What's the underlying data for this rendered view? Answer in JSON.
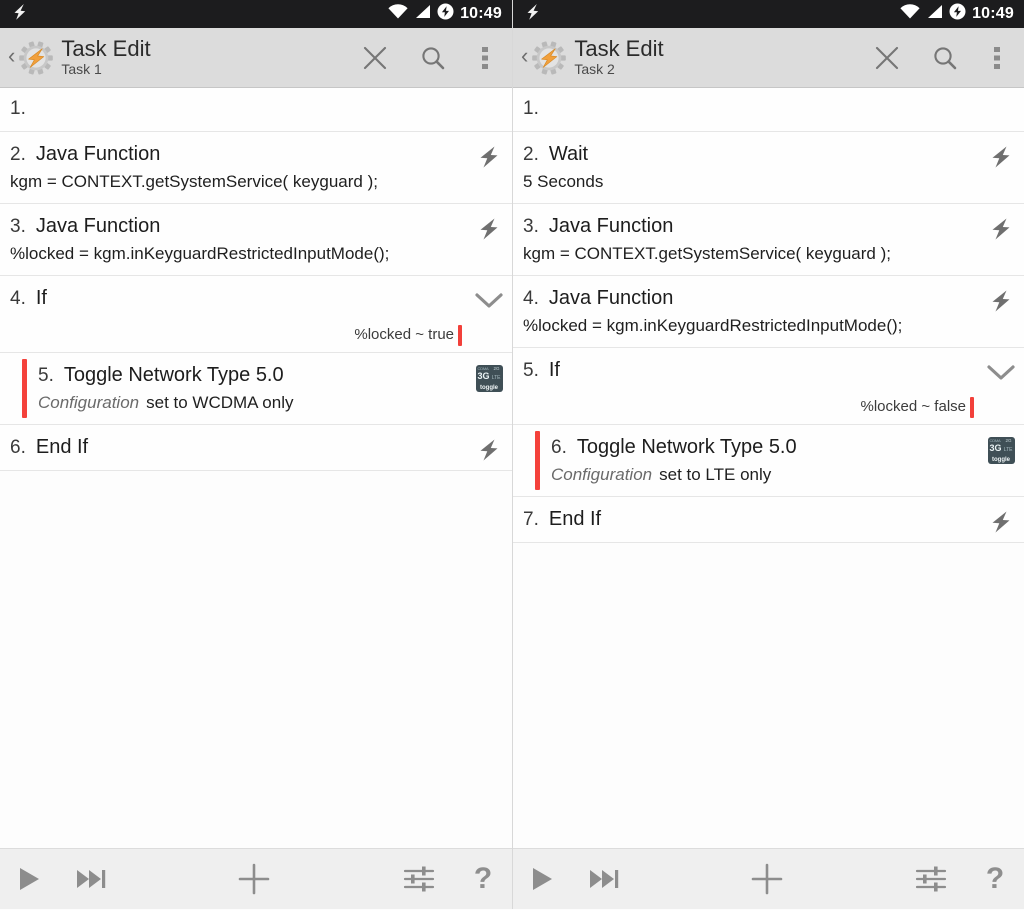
{
  "colors": {
    "statusbar_bg": "#1c1c1e",
    "actionbar_bg": "#dcdcdc",
    "accent_red": "#f2403a",
    "icon_gray": "#8e8e8e",
    "net_icon_bg": "#3f4f56",
    "brand_orange": "#f2a03c"
  },
  "panels": [
    {
      "id": "left",
      "statusbar": {
        "left_icon": "tasker-bolt-icon",
        "wifi_icon": "wifi-icon",
        "signal_icon": "cellular-signal-icon",
        "sync_icon": "clock-alarm-icon",
        "time": "10:49"
      },
      "actionbar": {
        "back_glyph": "‹",
        "app_icon": "tasker-gear-icon",
        "title": "Task Edit",
        "subtitle": "Task 1",
        "close_label": "close-icon",
        "search_label": "search-icon",
        "menu_label": "overflow-menu-icon"
      },
      "actions": [
        {
          "num": "1.",
          "name": "",
          "sub": "",
          "icon": "none",
          "indent": false,
          "empty": true
        },
        {
          "num": "2.",
          "name": "Java Function",
          "sub": "kgm = CONTEXT.getSystemService( keyguard );",
          "icon": "bolt",
          "indent": false
        },
        {
          "num": "3.",
          "name": "Java Function",
          "sub": "%locked = kgm.inKeyguardRestrictedInputMode();",
          "icon": "bolt",
          "indent": false
        },
        {
          "num": "4.",
          "name": "If",
          "sub": "",
          "condition": "%locked ~ true",
          "icon": "chevron",
          "indent": false
        },
        {
          "num": "5.",
          "name": "Toggle Network Type 5.0",
          "sub_label": "Configuration",
          "sub": "set to WCDMA only",
          "icon": "network",
          "indent": true
        },
        {
          "num": "6.",
          "name": "End If",
          "sub": "",
          "icon": "bolt",
          "indent": false
        }
      ],
      "bottombar": {
        "play": "play-icon",
        "step": "step-forward-icon",
        "add": "add-action-icon",
        "prefs": "sliders-icon",
        "help": "?"
      }
    },
    {
      "id": "right",
      "statusbar": {
        "left_icon": "tasker-bolt-icon",
        "wifi_icon": "wifi-icon",
        "signal_icon": "cellular-signal-icon",
        "sync_icon": "clock-alarm-icon",
        "time": "10:49"
      },
      "actionbar": {
        "back_glyph": "‹",
        "app_icon": "tasker-gear-icon",
        "title": "Task Edit",
        "subtitle": "Task 2",
        "close_label": "close-icon",
        "search_label": "search-icon",
        "menu_label": "overflow-menu-icon"
      },
      "actions": [
        {
          "num": "1.",
          "name": "",
          "sub": "",
          "icon": "none",
          "indent": false,
          "empty": true
        },
        {
          "num": "2.",
          "name": "Wait",
          "sub": "5 Seconds",
          "icon": "bolt",
          "indent": false
        },
        {
          "num": "3.",
          "name": "Java Function",
          "sub": "kgm = CONTEXT.getSystemService( keyguard );",
          "icon": "bolt",
          "indent": false
        },
        {
          "num": "4.",
          "name": "Java Function",
          "sub": "%locked = kgm.inKeyguardRestrictedInputMode();",
          "icon": "bolt",
          "indent": false
        },
        {
          "num": "5.",
          "name": "If",
          "sub": "",
          "condition": "%locked ~ false",
          "icon": "chevron",
          "indent": false
        },
        {
          "num": "6.",
          "name": "Toggle Network Type 5.0",
          "sub_label": "Configuration",
          "sub": "set to LTE only",
          "icon": "network",
          "indent": true
        },
        {
          "num": "7.",
          "name": "End If",
          "sub": "",
          "icon": "bolt",
          "indent": false
        }
      ],
      "bottombar": {
        "play": "play-icon",
        "step": "step-forward-icon",
        "add": "add-action-icon",
        "prefs": "sliders-icon",
        "help": "?"
      }
    }
  ],
  "net_icon_text": {
    "cdma": "CDMA",
    "g2": "2G",
    "g3": "3G",
    "lte": "LTE",
    "toggle": "toggle"
  }
}
